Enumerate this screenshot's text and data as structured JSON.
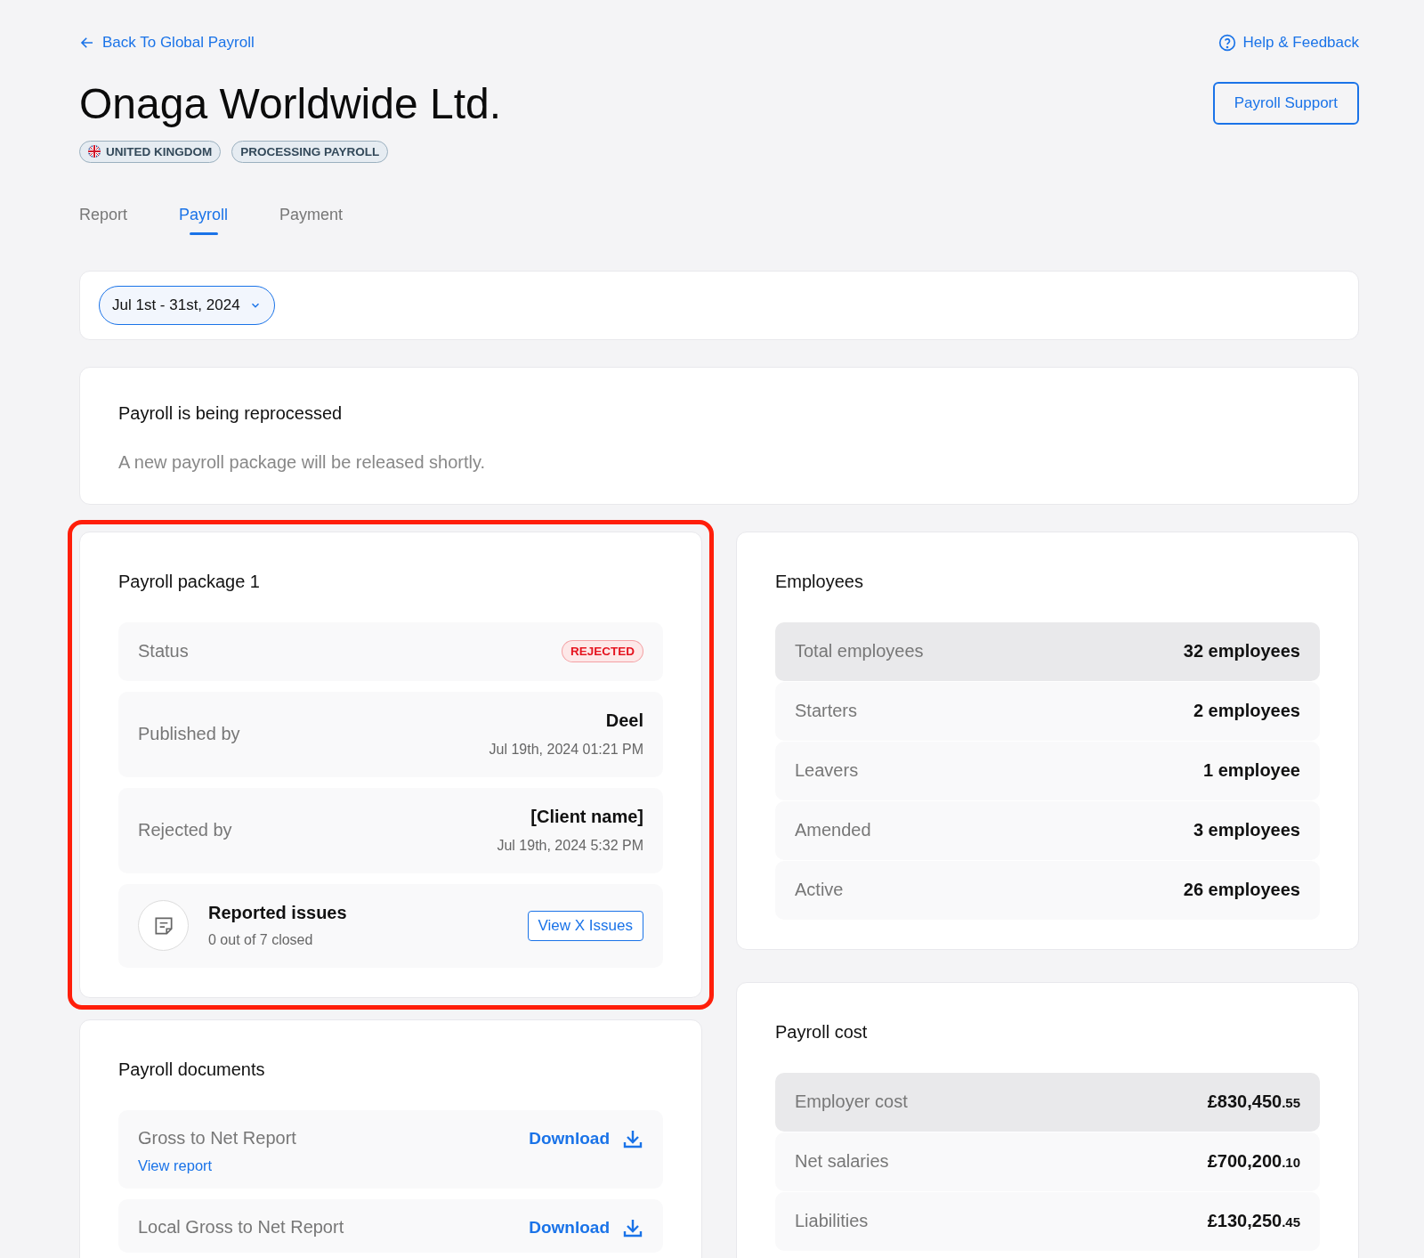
{
  "header": {
    "back_link": "Back To Global Payroll",
    "help_link": "Help & Feedback",
    "support_button": "Payroll Support",
    "title": "Onaga Worldwide Ltd.",
    "badges": [
      {
        "label": "UNITED KINGDOM",
        "kind": "country"
      },
      {
        "label": "PROCESSING PAYROLL",
        "kind": "status"
      }
    ]
  },
  "tabs": [
    {
      "label": "Report",
      "selected": false
    },
    {
      "label": "Payroll",
      "selected": true
    },
    {
      "label": "Payment",
      "selected": false
    }
  ],
  "period_selector": {
    "value": "Jul 1st - 31st, 2024"
  },
  "notice": {
    "title": "Payroll is being reprocessed",
    "text": "A new payroll package will be released shortly."
  },
  "package": {
    "title": "Payroll package 1",
    "highlighted": true,
    "status": {
      "label": "Status",
      "value": "REJECTED",
      "kind": "rejected"
    },
    "events": [
      {
        "label": "Published by",
        "who": "Deel",
        "when": "Jul 19th, 2024 01:21 PM"
      },
      {
        "label": "Rejected by",
        "who": "[Client name]",
        "when": "Jul 19th, 2024 5:32 PM"
      }
    ],
    "issues": {
      "title": "Reported issues",
      "subtitle": "0 out of 7 closed",
      "button": "View X Issues"
    }
  },
  "documents": {
    "title": "Payroll documents",
    "items": [
      {
        "name": "Gross to Net Report",
        "action": "Download",
        "link": "View report"
      },
      {
        "name": "Local Gross to Net Report",
        "action": "Download"
      }
    ]
  },
  "employees": {
    "title": "Employees",
    "rows": [
      {
        "label": "Total employees",
        "value": "32 employees",
        "shaded": true
      },
      {
        "label": "Starters",
        "value": "2 employees",
        "shaded": false
      },
      {
        "label": "Leavers",
        "value": "1 employee",
        "shaded": false
      },
      {
        "label": "Amended",
        "value": "3 employees",
        "shaded": false
      },
      {
        "label": "Active",
        "value": "26 employees",
        "shaded": false
      }
    ]
  },
  "cost": {
    "title": "Payroll cost",
    "rows": [
      {
        "label": "Employer cost",
        "value": "£830,450",
        "decimals": ".55",
        "shaded": true
      },
      {
        "label": "Net salaries",
        "value": "£700,200",
        "decimals": ".10",
        "shaded": false
      },
      {
        "label": "Liabilities",
        "value": "£130,250",
        "decimals": ".45",
        "shaded": false
      }
    ]
  }
}
